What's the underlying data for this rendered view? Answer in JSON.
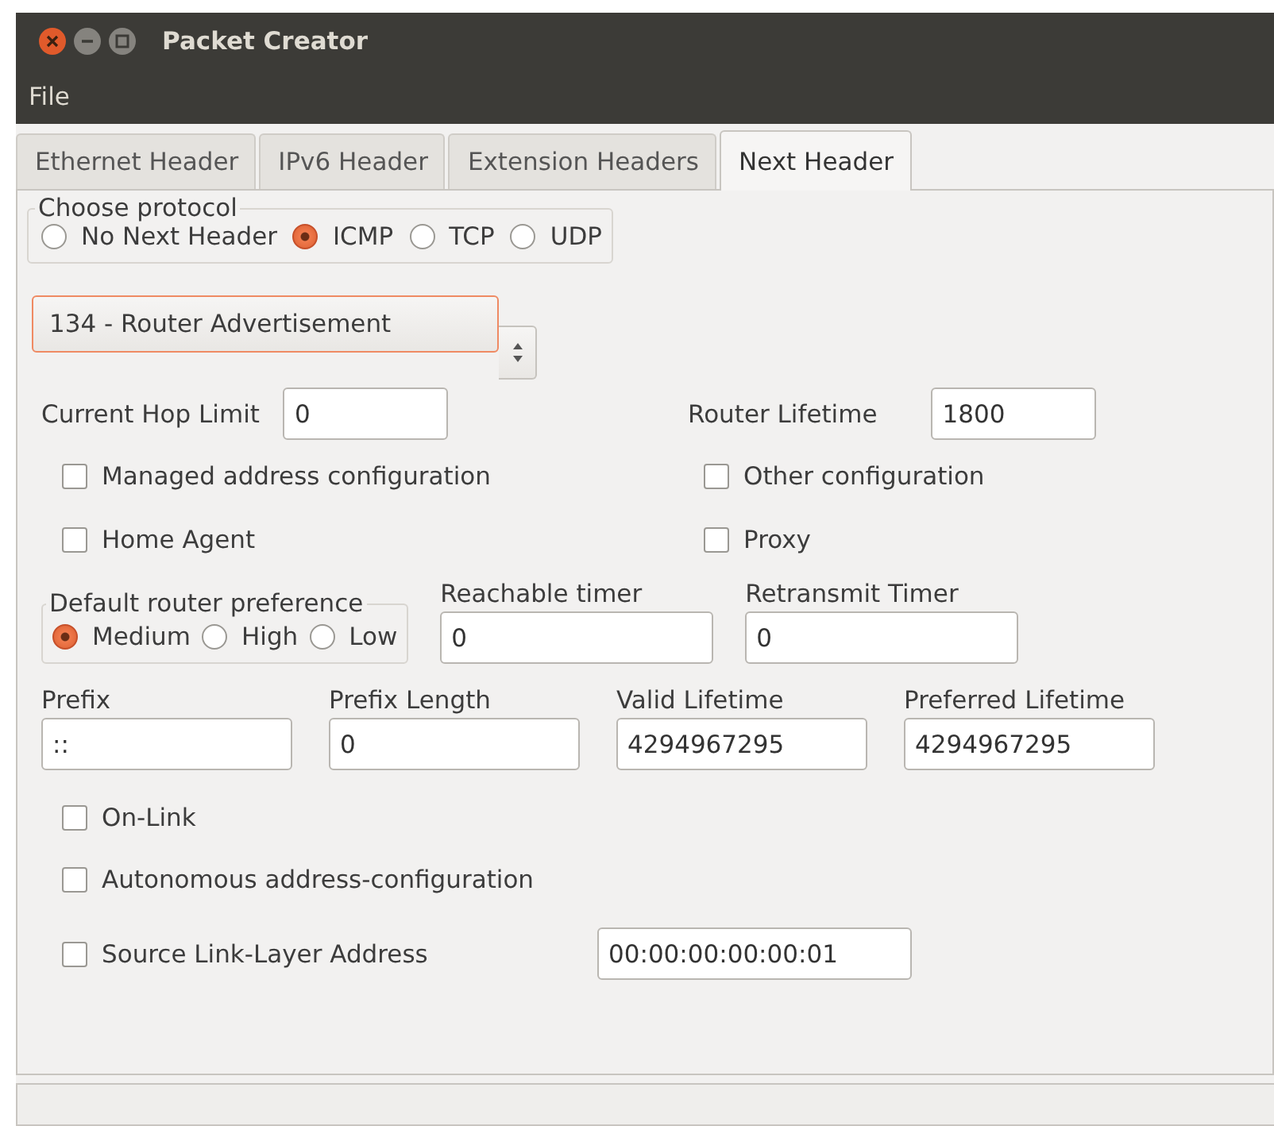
{
  "window": {
    "title": "Packet Creator"
  },
  "menu": [
    "File"
  ],
  "tabs": [
    {
      "label": "Ethernet Header",
      "selected": false
    },
    {
      "label": "IPv6 Header",
      "selected": false
    },
    {
      "label": "Extension Headers",
      "selected": false
    },
    {
      "label": "Next Header",
      "selected": true
    }
  ],
  "protocol": {
    "label": "Choose protocol",
    "options": [
      {
        "label": "No Next Header",
        "selected": false
      },
      {
        "label": "ICMP",
        "selected": true
      },
      {
        "label": "TCP",
        "selected": false
      },
      {
        "label": "UDP",
        "selected": false
      }
    ]
  },
  "icmp_type": {
    "value": "134 - Router Advertisement"
  },
  "hop_limit": {
    "label": "Current Hop Limit",
    "value": "0"
  },
  "router_lifetime": {
    "label": "Router Lifetime",
    "value": "1800"
  },
  "flags": [
    {
      "label": "Managed address configuration",
      "checked": false
    },
    {
      "label": "Other configuration",
      "checked": false
    },
    {
      "label": "Home Agent",
      "checked": false
    },
    {
      "label": "Proxy",
      "checked": false
    }
  ],
  "preference": {
    "label": "Default router preference",
    "options": [
      {
        "label": "Medium",
        "selected": true
      },
      {
        "label": "High",
        "selected": false
      },
      {
        "label": "Low",
        "selected": false
      }
    ]
  },
  "timers": [
    {
      "label": "Reachable timer",
      "value": "0"
    },
    {
      "label": "Retransmit Timer",
      "value": "0"
    }
  ],
  "prefix_fields": [
    {
      "label": "Prefix",
      "value": "::"
    },
    {
      "label": "Prefix Length",
      "value": "0"
    },
    {
      "label": "Valid Lifetime",
      "value": "4294967295"
    },
    {
      "label": "Preferred Lifetime",
      "value": "4294967295"
    }
  ],
  "prefix_flags": [
    {
      "label": "On-Link",
      "checked": false
    },
    {
      "label": "Autonomous address-configuration",
      "checked": false
    }
  ],
  "source_link_layer": {
    "label": "Source Link-Layer Address",
    "checked": false,
    "value": "00:00:00:00:00:01"
  }
}
